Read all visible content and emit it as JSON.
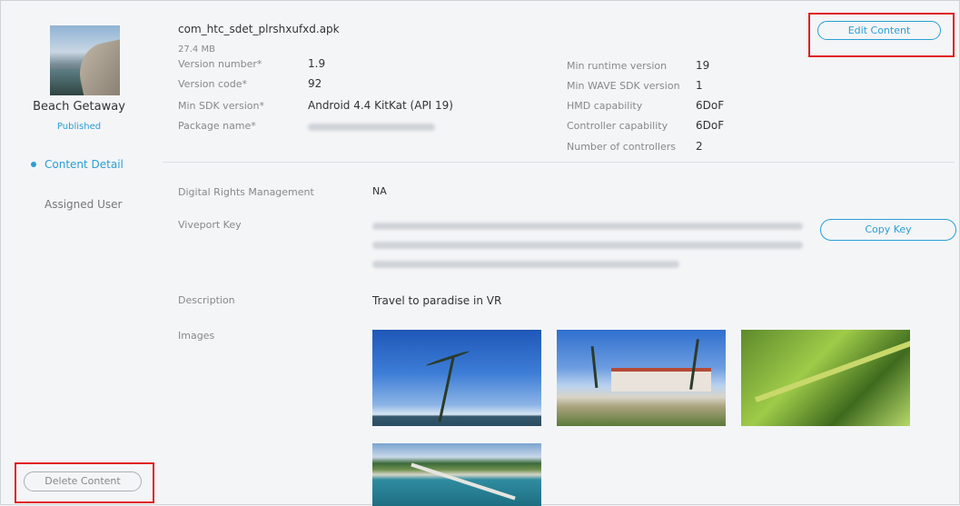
{
  "sidebar": {
    "app_name": "Beach Getaway",
    "status": "Published",
    "nav": [
      {
        "label": "Content Detail",
        "active": true
      },
      {
        "label": "Assigned User",
        "active": false
      }
    ],
    "delete_label": "Delete Content"
  },
  "header": {
    "filename": "com_htc_sdet_plrshxufxd.apk",
    "filesize": "27.4 MB",
    "edit_label": "Edit Content"
  },
  "details_left": [
    {
      "label": "Version number*",
      "value": "1.9"
    },
    {
      "label": "Version code*",
      "value": "92"
    },
    {
      "label": "Min SDK version*",
      "value": "Android 4.4 KitKat (API 19)"
    },
    {
      "label": "Package name*",
      "value": ""
    }
  ],
  "details_right": [
    {
      "label": "Min runtime version",
      "value": "19"
    },
    {
      "label": "Min WAVE SDK version",
      "value": "1"
    },
    {
      "label": "HMD capability",
      "value": "6DoF"
    },
    {
      "label": "Controller capability",
      "value": "6DoF"
    },
    {
      "label": "Number of controllers",
      "value": "2"
    }
  ],
  "drm": {
    "label": "Digital Rights Management",
    "value": "NA"
  },
  "viveport_key": {
    "label": "Viveport Key",
    "copy_label": "Copy Key"
  },
  "description": {
    "label": "Description",
    "value": "Travel to paradise in VR"
  },
  "images": {
    "label": "Images"
  },
  "colors": {
    "accent": "#2a9fd6",
    "highlight": "#e02020",
    "background": "#f4f5f7"
  }
}
